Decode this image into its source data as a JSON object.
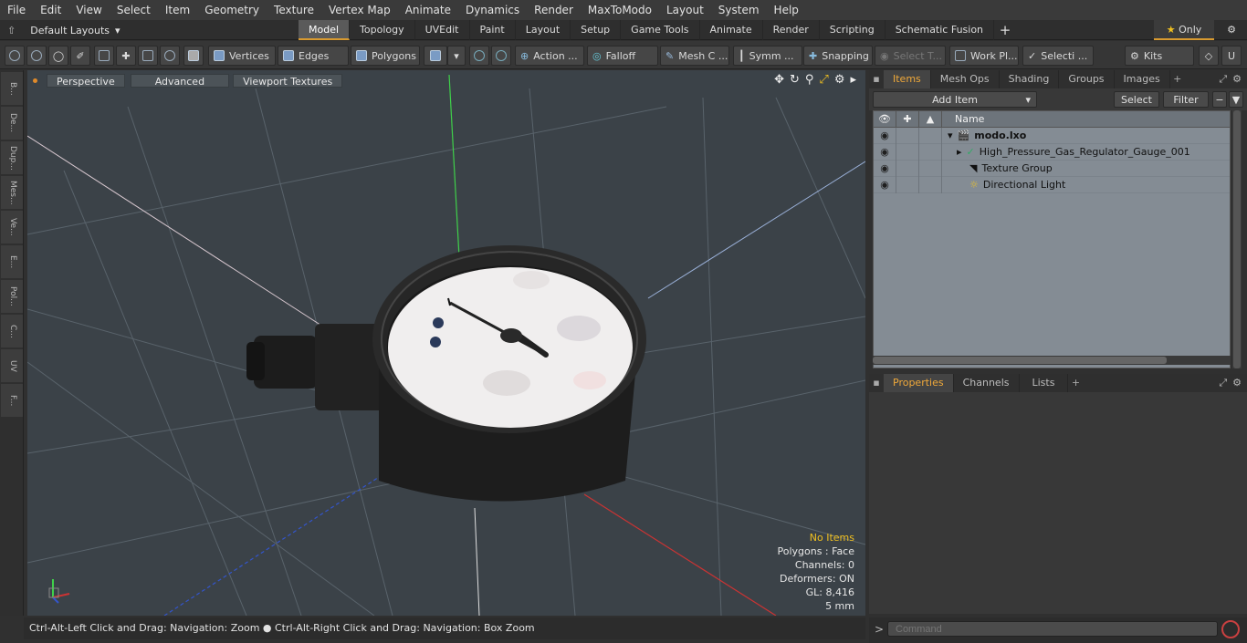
{
  "menu": [
    "File",
    "Edit",
    "View",
    "Select",
    "Item",
    "Geometry",
    "Texture",
    "Vertex Map",
    "Animate",
    "Dynamics",
    "Render",
    "MaxToModo",
    "Layout",
    "System",
    "Help"
  ],
  "layouts_label": "Default Layouts",
  "mode_tabs": [
    {
      "label": "Model",
      "active": true
    },
    {
      "label": "Topology",
      "active": false
    },
    {
      "label": "UVEdit",
      "active": false
    },
    {
      "label": "Paint",
      "active": false
    },
    {
      "label": "Layout",
      "active": false
    },
    {
      "label": "Setup",
      "active": false
    },
    {
      "label": "Game Tools",
      "active": false
    },
    {
      "label": "Animate",
      "active": false
    },
    {
      "label": "Render",
      "active": false
    },
    {
      "label": "Scripting",
      "active": false
    },
    {
      "label": "Schematic Fusion",
      "active": false
    }
  ],
  "only_label": "Only",
  "toolbar": {
    "vertices": "Vertices",
    "edges": "Edges",
    "polygons": "Polygons",
    "action": "Action ...",
    "falloff": "Falloff",
    "mesh": "Mesh C ...",
    "symm": "Symm ...",
    "snapping": "Snapping",
    "select_t": "Select T...",
    "work_pl": "Work Pl...",
    "selecti": "Selecti ...",
    "kits": "Kits"
  },
  "left_tabs": [
    "B...",
    "De...",
    "Dup...",
    "Mes...",
    "Ve...",
    "E...",
    "Pol...",
    "C...",
    "UV",
    "F..."
  ],
  "viewport": {
    "view_mode": "Perspective",
    "advanced": "Advanced",
    "textures": "Viewport Textures",
    "info": {
      "no_items": "No Items",
      "polygons": "Polygons : Face",
      "channels": "Channels: 0",
      "deformers": "Deformers: ON",
      "gl": "GL: 8,416",
      "scale": "5 mm"
    }
  },
  "status": "Ctrl-Alt-Left Click and Drag: Navigation: Zoom ● Ctrl-Alt-Right Click and Drag: Navigation: Box Zoom",
  "items_panel": {
    "tabs": [
      {
        "label": "Items",
        "active": true
      },
      {
        "label": "Mesh Ops",
        "active": false
      },
      {
        "label": "Shading",
        "active": false
      },
      {
        "label": "Groups",
        "active": false
      },
      {
        "label": "Images",
        "active": false
      }
    ],
    "add_item": "Add Item",
    "select": "Select",
    "filter": "Filter",
    "column_name": "Name",
    "rows": [
      {
        "label": "modo.lxo",
        "bold": true
      },
      {
        "label": "High_Pressure_Gas_Regulator_Gauge_001",
        "bold": false
      },
      {
        "label": "Texture Group",
        "bold": false
      },
      {
        "label": "Directional Light",
        "bold": false
      }
    ]
  },
  "props_panel": {
    "tabs": [
      {
        "label": "Properties",
        "active": true
      },
      {
        "label": "Channels",
        "active": false
      },
      {
        "label": "Lists",
        "active": false
      }
    ]
  },
  "command_placeholder": "Command"
}
